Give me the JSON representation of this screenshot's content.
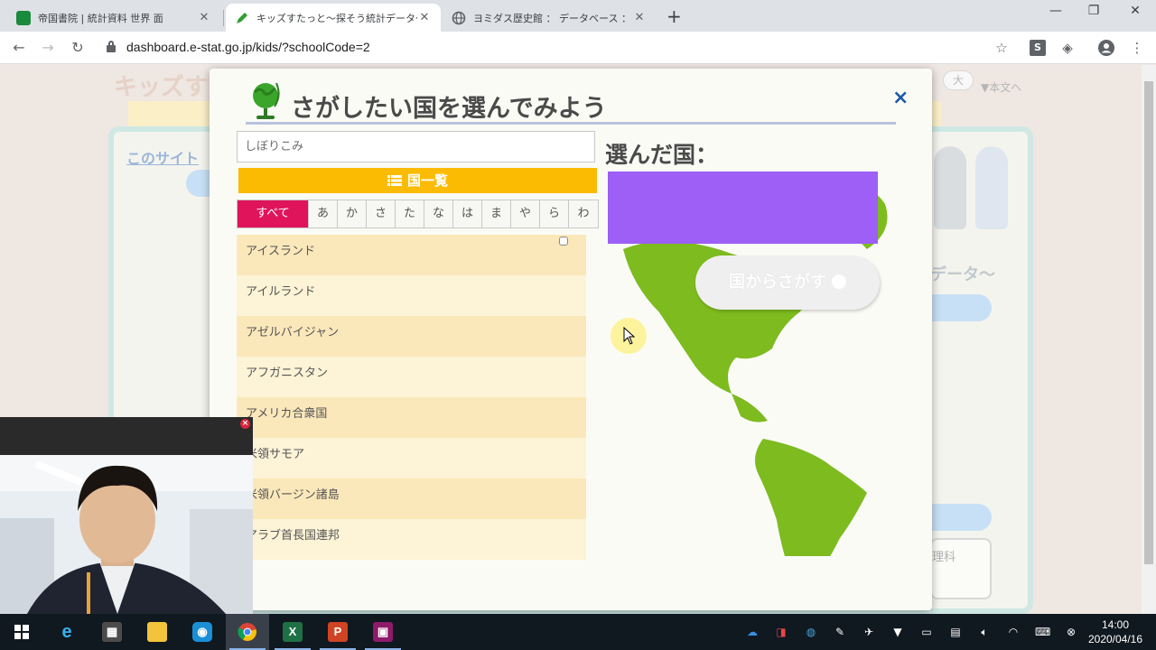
{
  "browser": {
    "tabs": [
      {
        "title": "帝国書院 | 統計資料 世界 面",
        "favicon_color": "#1a8a3c",
        "active": false
      },
      {
        "title": "キッズすたっと～探そう統計データ～",
        "favicon_color": "#2e9e2e",
        "active": true
      },
      {
        "title": "ヨミダス歴史館 ： データベース ： YC",
        "favicon_color": "#5f6368",
        "active": false
      }
    ],
    "new_tab_icon": "+",
    "url": "dashboard.e-stat.go.jp/kids/?schoolCode=2",
    "window_controls": [
      "minimize",
      "restore",
      "close"
    ]
  },
  "background_page": {
    "logo_text": "キッズす",
    "site_link": "このサイト",
    "size_button": "大",
    "honbun_link": "▼本文へ",
    "right_heading": "データ～",
    "subject_label": "理科"
  },
  "modal": {
    "title": "さがしたい国を選んでみよう",
    "close_symbol": "×",
    "filter_placeholder": "しぼりこみ",
    "filter_value": "",
    "list_header": "国一覧",
    "kana_tabs": [
      "すべて",
      "あ",
      "か",
      "さ",
      "た",
      "な",
      "は",
      "ま",
      "や",
      "ら",
      "わ"
    ],
    "active_kana_tab": "すべて",
    "countries": [
      "アイスランド",
      "アイルランド",
      "アゼルバイジャン",
      "アフガニスタン",
      "アメリカ合衆国",
      "米領サモア",
      "米領バージン諸島",
      "アラブ首長国連邦"
    ],
    "selected_label": "選んだ国：",
    "selected_value": "",
    "search_button_label": "国からさがす",
    "colors": {
      "header_yellow": "#fcbb03",
      "active_tab_pink": "#e0145a",
      "selected_purple": "#9d5ff5",
      "close_blue": "#1c5aa6",
      "map_green": "#7dbb1f"
    }
  },
  "taskbar": {
    "apps": [
      "start",
      "internet-explorer",
      "calculator",
      "file-explorer",
      "app-blue",
      "chrome",
      "excel",
      "powerpoint",
      "video-app"
    ],
    "time": "14:00",
    "date": "2020/04/16"
  }
}
